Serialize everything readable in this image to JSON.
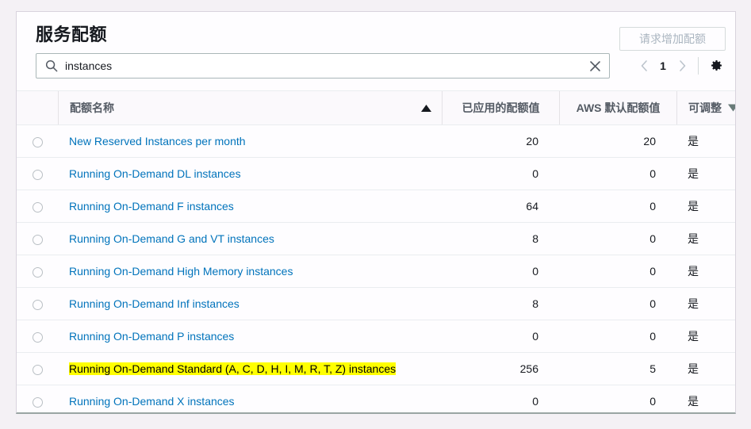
{
  "card": {
    "title": "服务配额",
    "request_button": {
      "label": "请求增加配额",
      "state": "disabled"
    }
  },
  "search": {
    "icon": "search-icon",
    "value": "instances",
    "placeholder": "",
    "clear_icon": "close-icon"
  },
  "pagination": {
    "prev_icon": "chevron-left-icon",
    "current_page": "1",
    "next_icon": "chevron-right-icon",
    "settings_icon": "gear-icon"
  },
  "table": {
    "columns": [
      {
        "key": "select",
        "label": ""
      },
      {
        "key": "name",
        "label": "配额名称",
        "sort_icon": "triangle-up-icon",
        "sorted": "ascending"
      },
      {
        "key": "applied",
        "label": "已应用的配额值"
      },
      {
        "key": "default",
        "label": "AWS 默认配额值"
      },
      {
        "key": "adjustable",
        "label": "可调整",
        "filter_icon": "triangle-down-icon"
      }
    ],
    "rows": [
      {
        "name": "New Reserved Instances per month",
        "applied": "20",
        "default": "20",
        "adjustable": "是",
        "highlighted": false
      },
      {
        "name": "Running On-Demand DL instances",
        "applied": "0",
        "default": "0",
        "adjustable": "是",
        "highlighted": false
      },
      {
        "name": "Running On-Demand F instances",
        "applied": "64",
        "default": "0",
        "adjustable": "是",
        "highlighted": false
      },
      {
        "name": "Running On-Demand G and VT instances",
        "applied": "8",
        "default": "0",
        "adjustable": "是",
        "highlighted": false
      },
      {
        "name": "Running On-Demand High Memory instances",
        "applied": "0",
        "default": "0",
        "adjustable": "是",
        "highlighted": false
      },
      {
        "name": "Running On-Demand Inf instances",
        "applied": "8",
        "default": "0",
        "adjustable": "是",
        "highlighted": false
      },
      {
        "name": "Running On-Demand P instances",
        "applied": "0",
        "default": "0",
        "adjustable": "是",
        "highlighted": false
      },
      {
        "name": "Running On-Demand Standard (A, C, D, H, I, M, R, T, Z) instances",
        "applied": "256",
        "default": "5",
        "adjustable": "是",
        "highlighted": true
      },
      {
        "name": "Running On-Demand X instances",
        "applied": "0",
        "default": "0",
        "adjustable": "是",
        "highlighted": false
      }
    ]
  },
  "colors": {
    "link": "#0073bb",
    "highlight": "#ffff00",
    "page_background": "#f4f1f5",
    "card_background": "#fefdff",
    "header_text": "#545b64",
    "disabled_text": "#aab5c0"
  }
}
